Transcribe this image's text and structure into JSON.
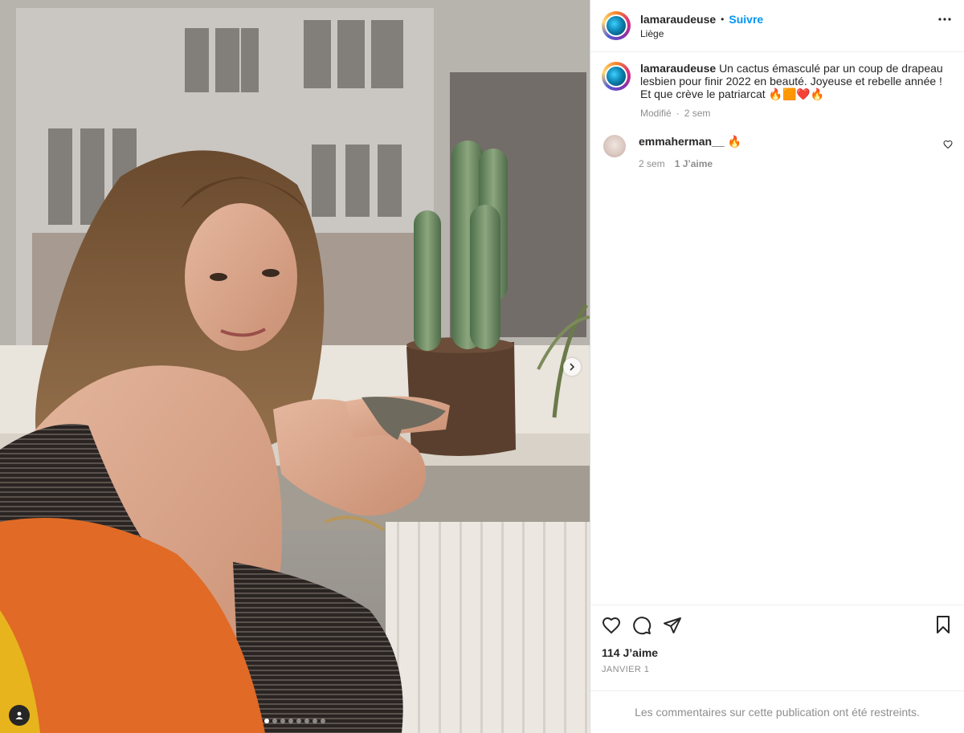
{
  "header": {
    "username": "lamaraudeuse",
    "separator": "•",
    "follow_label": "Suivre",
    "location": "Liège"
  },
  "caption": {
    "username": "lamaraudeuse",
    "text": "Un cactus émasculé par un coup de drapeau lesbien pour finir 2022 en beauté. Joyeuse et rebelle année ! Et que crève le patriarcat 🔥🟧❤️🔥",
    "edited": "Modifié",
    "meta_sep": "·",
    "time": "2 sem"
  },
  "comments": [
    {
      "username": "emmaherman__",
      "text": "🔥",
      "time": "2 sem",
      "likes": "1 J’aime"
    }
  ],
  "stats": {
    "likes": "114 J’aime",
    "date": "JANVIER 1"
  },
  "footer": {
    "restricted": "Les commentaires sur cette publication ont été restreints."
  },
  "carousel": {
    "slide_count": 8,
    "active_index": 0
  },
  "colors": {
    "accent": "#0095f6",
    "muted": "#8e8e8e",
    "text": "#262626"
  },
  "icons": [
    "more-options-icon",
    "heart-icon",
    "comment-icon",
    "share-icon",
    "bookmark-icon",
    "chevron-right-icon",
    "user-tag-icon"
  ]
}
